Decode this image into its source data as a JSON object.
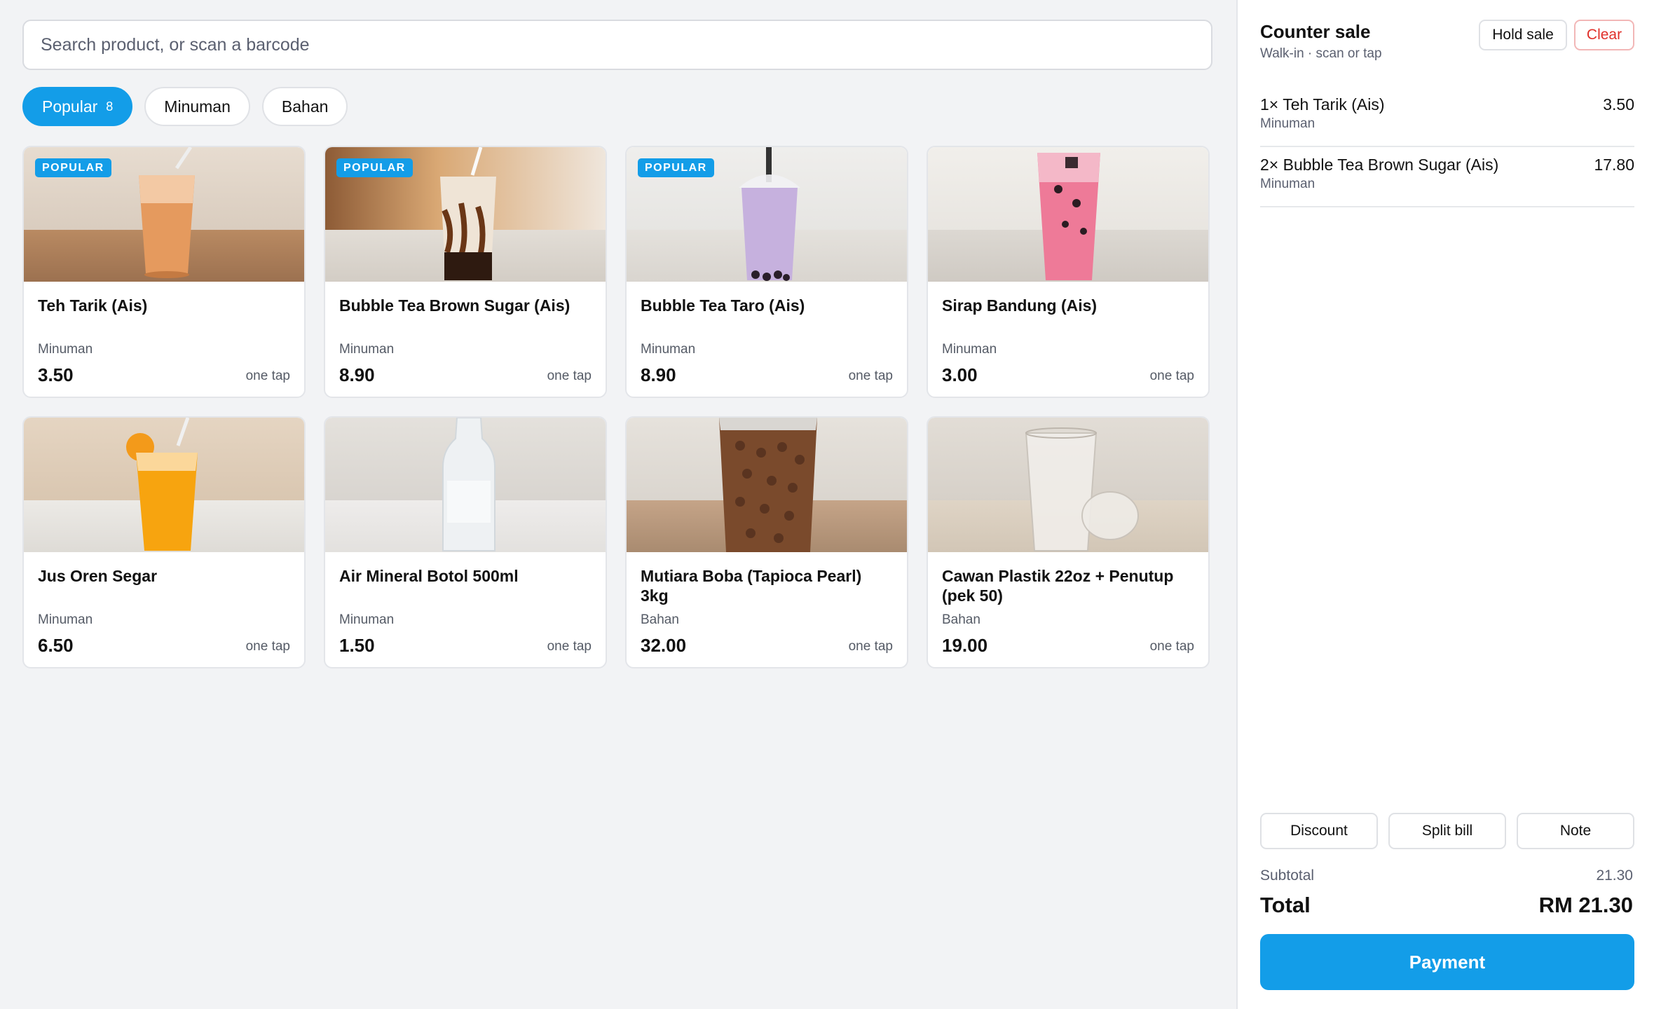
{
  "search": {
    "placeholder": "Search product, or scan a barcode"
  },
  "chips": [
    {
      "label": "Popular",
      "count": "8",
      "active": true
    },
    {
      "label": "Minuman",
      "active": false
    },
    {
      "label": "Bahan",
      "active": false
    }
  ],
  "products": [
    {
      "name": "Teh Tarik (Ais)",
      "category": "Minuman",
      "price": "3.50",
      "tap": "one tap",
      "badge": "POPULAR",
      "image": "iced-milk-tea"
    },
    {
      "name": "Bubble Tea Brown Sugar (Ais)",
      "category": "Minuman",
      "price": "8.90",
      "tap": "one tap",
      "badge": "POPULAR",
      "image": "brown-sugar-boba"
    },
    {
      "name": "Bubble Tea Taro (Ais)",
      "category": "Minuman",
      "price": "8.90",
      "tap": "one tap",
      "badge": "POPULAR",
      "image": "taro-boba"
    },
    {
      "name": "Sirap Bandung (Ais)",
      "category": "Minuman",
      "price": "3.00",
      "tap": "one tap",
      "badge": "",
      "image": "pink-rose-drink"
    },
    {
      "name": "Jus Oren Segar",
      "category": "Minuman",
      "price": "6.50",
      "tap": "one tap",
      "badge": "",
      "image": "orange-juice"
    },
    {
      "name": "Air Mineral Botol 500ml",
      "category": "Minuman",
      "price": "1.50",
      "tap": "one tap",
      "badge": "",
      "image": "water-bottle"
    },
    {
      "name": "Mutiara Boba (Tapioca Pearl) 3kg",
      "category": "Bahan",
      "price": "32.00",
      "tap": "one tap",
      "badge": "",
      "image": "tapioca-pearl-bag"
    },
    {
      "name": "Cawan Plastik 22oz + Penutup (pek 50)",
      "category": "Bahan",
      "price": "19.00",
      "tap": "one tap",
      "badge": "",
      "image": "plastic-cup"
    }
  ],
  "cart": {
    "title": "Counter sale",
    "subtitle": "Walk-in · scan or tap",
    "hold_label": "Hold sale",
    "clear_label": "Clear",
    "lines": [
      {
        "name": "1× Teh Tarik (Ais)",
        "category": "Minuman",
        "amount": "3.50"
      },
      {
        "name": "2× Bubble Tea Brown Sugar (Ais)",
        "category": "Minuman",
        "amount": "17.80"
      }
    ],
    "discount_label": "Discount",
    "split_label": "Split bill",
    "note_label": "Note",
    "subtotal_label": "Subtotal",
    "subtotal_value": "21.30",
    "total_label": "Total",
    "total_value": "RM 21.30",
    "payment_label": "Payment"
  },
  "colors": {
    "accent": "#139de8",
    "danger": "#e0302a"
  }
}
